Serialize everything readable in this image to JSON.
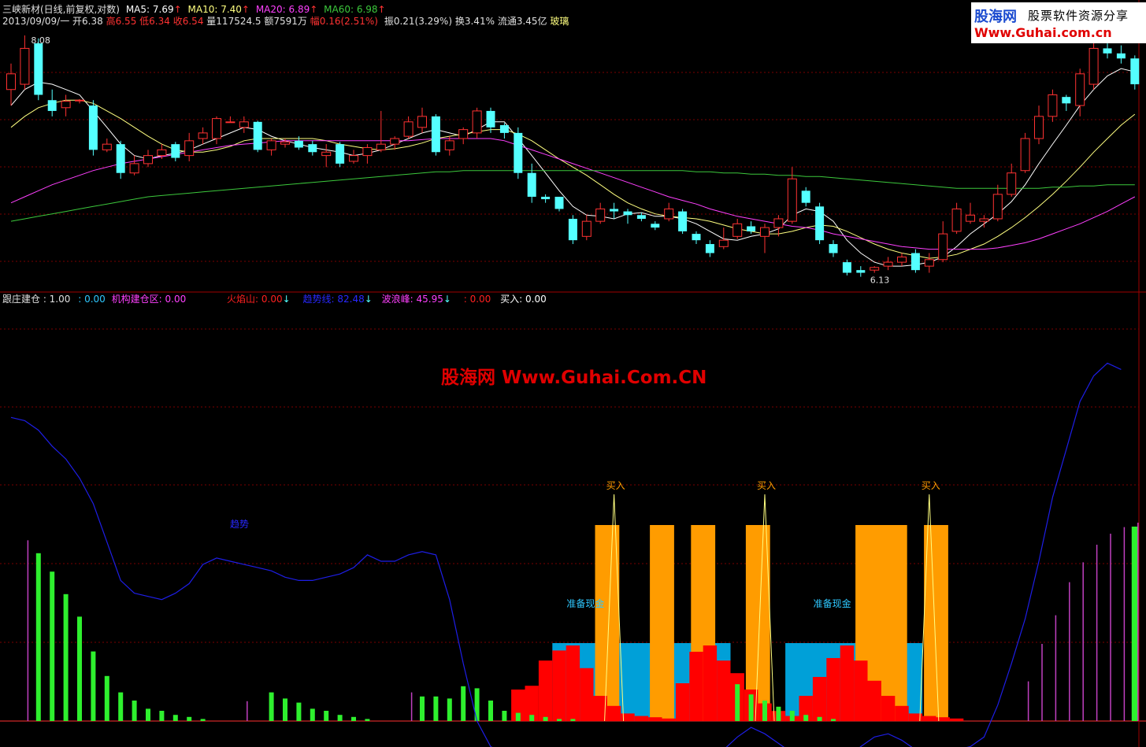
{
  "header": {
    "title": "三峡新材(日线,前复权,对数)",
    "ma5": "MA5: 7.69",
    "ma10": "MA10: 7.40",
    "ma20": "MA20: 6.89",
    "ma60": "MA60: 6.98",
    "up_arrow": "↑",
    "date": "2013/09/09/一",
    "open": "开6.38",
    "high": "高6.55",
    "low": "低6.34",
    "close": "收6.54",
    "volume": "量117524.5",
    "amount": "额7591万",
    "change": "幅0.16(2.51%)",
    "amplitude": "振0.21(3.29%)",
    "turnover": "换3.41%",
    "float": "流通3.45亿",
    "sector": "玻璃"
  },
  "watermark": {
    "logo": "股海网",
    "slogan": "股票软件资源分享",
    "url": "Www.Guhai.com.cn",
    "center": "股海网 Www.Guhai.Com.CN"
  },
  "indicator": {
    "label1": "跟庄建仓 : 1.00",
    "label2": ": 0.00",
    "label3": "机构建仓区: 0.00",
    "label4": "火焰山: 0.00",
    "label5": "趋势线: 82.48",
    "label6": "波浪峰: 45.95",
    "label7": ": 0.00",
    "label8": "买入: 0.00",
    "down_arrow": "↓"
  },
  "colors": {
    "up": "#ff3232",
    "down": "#54ffff",
    "ma5": "#ffffff",
    "ma10": "#ffff80",
    "ma20": "#ff40ff",
    "ma60": "#3cc83c",
    "trend": "#1e1ee6",
    "orange": "#ff9c00",
    "blue_zone": "#00a0d8",
    "fire": "#ff0000",
    "green_bar": "#2ef02e",
    "purple_bar": "#c040c0"
  },
  "chart_data": [
    {
      "type": "candlestick",
      "price_labels": {
        "max": "8.08",
        "min": "6.13"
      },
      "candles": [
        [
          7.55,
          7.8,
          7.4,
          7.7
        ],
        [
          7.6,
          8.08,
          7.55,
          7.95
        ],
        [
          8.0,
          8.05,
          7.45,
          7.5
        ],
        [
          7.45,
          7.55,
          7.3,
          7.35
        ],
        [
          7.38,
          7.5,
          7.3,
          7.44
        ],
        [
          7.45,
          7.46,
          7.42,
          7.45
        ],
        [
          7.4,
          7.45,
          6.95,
          7.0
        ],
        [
          7.0,
          7.1,
          6.98,
          7.05
        ],
        [
          7.05,
          7.08,
          6.75,
          6.8
        ],
        [
          6.8,
          6.95,
          6.78,
          6.88
        ],
        [
          6.88,
          7.0,
          6.85,
          6.95
        ],
        [
          6.95,
          7.05,
          6.92,
          7.0
        ],
        [
          7.05,
          7.07,
          6.9,
          6.93
        ],
        [
          6.95,
          7.15,
          6.9,
          7.08
        ],
        [
          7.1,
          7.2,
          7.05,
          7.15
        ],
        [
          7.1,
          7.3,
          7.05,
          7.28
        ],
        [
          7.25,
          7.3,
          7.25,
          7.25
        ],
        [
          7.2,
          7.3,
          7.15,
          7.25
        ],
        [
          7.25,
          7.26,
          6.98,
          7.0
        ],
        [
          7.0,
          7.1,
          6.95,
          7.08
        ],
        [
          7.05,
          7.1,
          7.02,
          7.07
        ],
        [
          7.08,
          7.12,
          7.0,
          7.02
        ],
        [
          7.05,
          7.08,
          6.95,
          6.98
        ],
        [
          6.95,
          7.05,
          6.85,
          6.98
        ],
        [
          7.05,
          7.07,
          6.85,
          6.88
        ],
        [
          6.9,
          7.0,
          6.88,
          6.95
        ],
        [
          6.95,
          7.05,
          6.88,
          7.02
        ],
        [
          7.0,
          7.35,
          6.98,
          7.05
        ],
        [
          7.05,
          7.12,
          7.0,
          7.1
        ],
        [
          7.12,
          7.3,
          7.1,
          7.25
        ],
        [
          7.2,
          7.38,
          7.15,
          7.3
        ],
        [
          7.3,
          7.32,
          6.95,
          6.98
        ],
        [
          7.0,
          7.12,
          6.95,
          7.08
        ],
        [
          7.1,
          7.2,
          7.05,
          7.18
        ],
        [
          7.15,
          7.38,
          7.1,
          7.35
        ],
        [
          7.35,
          7.38,
          7.15,
          7.2
        ],
        [
          7.22,
          7.24,
          7.1,
          7.15
        ],
        [
          7.15,
          7.2,
          6.75,
          6.8
        ],
        [
          6.8,
          6.88,
          6.55,
          6.6
        ],
        [
          6.6,
          6.62,
          6.55,
          6.58
        ],
        [
          6.6,
          6.6,
          6.48,
          6.5
        ],
        [
          6.42,
          6.45,
          6.22,
          6.25
        ],
        [
          6.28,
          6.45,
          6.25,
          6.4
        ],
        [
          6.4,
          6.55,
          6.38,
          6.5
        ],
        [
          6.5,
          6.55,
          6.42,
          6.48
        ],
        [
          6.48,
          6.5,
          6.38,
          6.45
        ],
        [
          6.45,
          6.47,
          6.4,
          6.42
        ],
        [
          6.38,
          6.4,
          6.33,
          6.35
        ],
        [
          6.42,
          6.55,
          6.4,
          6.5
        ],
        [
          6.48,
          6.5,
          6.3,
          6.32
        ],
        [
          6.3,
          6.32,
          6.22,
          6.25
        ],
        [
          6.22,
          6.25,
          6.12,
          6.15
        ],
        [
          6.2,
          6.35,
          6.18,
          6.25
        ],
        [
          6.28,
          6.42,
          6.26,
          6.38
        ],
        [
          6.36,
          6.4,
          6.3,
          6.32
        ],
        [
          6.28,
          6.38,
          6.15,
          6.35
        ],
        [
          6.35,
          6.45,
          6.28,
          6.42
        ],
        [
          6.4,
          6.85,
          6.38,
          6.75
        ],
        [
          6.65,
          6.68,
          6.52,
          6.55
        ],
        [
          6.52,
          6.55,
          6.22,
          6.25
        ],
        [
          6.22,
          6.25,
          6.12,
          6.15
        ],
        [
          6.08,
          6.1,
          5.98,
          6.0
        ],
        [
          6.02,
          6.05,
          5.97,
          6.0
        ],
        [
          6.02,
          6.05,
          6.0,
          6.04
        ],
        [
          6.05,
          6.12,
          6.02,
          6.08
        ],
        [
          6.08,
          6.15,
          6.05,
          6.12
        ],
        [
          6.15,
          6.18,
          6.0,
          6.02
        ],
        [
          6.05,
          6.15,
          6.0,
          6.1
        ],
        [
          6.1,
          6.4,
          6.08,
          6.3
        ],
        [
          6.32,
          6.55,
          6.3,
          6.5
        ],
        [
          6.4,
          6.55,
          6.38,
          6.45
        ],
        [
          6.4,
          6.45,
          6.35,
          6.42
        ],
        [
          6.42,
          6.7,
          6.4,
          6.62
        ],
        [
          6.62,
          6.88,
          6.6,
          6.8
        ],
        [
          6.82,
          7.15,
          6.8,
          7.1
        ],
        [
          7.1,
          7.4,
          7.05,
          7.3
        ],
        [
          7.3,
          7.55,
          7.25,
          7.5
        ],
        [
          7.48,
          7.5,
          7.35,
          7.42
        ],
        [
          7.4,
          7.75,
          7.3,
          7.7
        ],
        [
          7.6,
          8.05,
          7.55,
          7.95
        ],
        [
          7.95,
          8.0,
          7.85,
          7.9
        ],
        [
          7.9,
          7.98,
          7.8,
          7.85
        ],
        [
          7.85,
          7.88,
          7.55,
          7.6
        ]
      ],
      "series": [
        {
          "name": "MA5",
          "values": [
            7.4,
            7.55,
            7.62,
            7.6,
            7.55,
            7.5,
            7.35,
            7.2,
            7.05,
            6.95,
            6.92,
            6.95,
            6.97,
            7.0,
            7.05,
            7.1,
            7.15,
            7.2,
            7.18,
            7.12,
            7.08,
            7.05,
            7.02,
            7.0,
            6.98,
            6.95,
            6.97,
            7.0,
            7.05,
            7.1,
            7.15,
            7.18,
            7.15,
            7.12,
            7.18,
            7.25,
            7.25,
            7.1,
            6.95,
            6.8,
            6.65,
            6.52,
            6.45,
            6.44,
            6.42,
            6.46,
            6.47,
            6.44,
            6.44,
            6.42,
            6.38,
            6.32,
            6.26,
            6.25,
            6.28,
            6.3,
            6.34,
            6.45,
            6.5,
            6.48,
            6.4,
            6.25,
            6.15,
            6.08,
            6.05,
            6.05,
            6.06,
            6.08,
            6.12,
            6.2,
            6.3,
            6.38,
            6.46,
            6.56,
            6.7,
            6.88,
            7.05,
            7.22,
            7.4,
            7.55,
            7.68,
            7.75,
            7.72
          ]
        },
        {
          "name": "MA10",
          "values": [
            7.2,
            7.3,
            7.38,
            7.42,
            7.45,
            7.45,
            7.42,
            7.35,
            7.28,
            7.2,
            7.12,
            7.05,
            7.0,
            6.98,
            6.98,
            7.0,
            7.03,
            7.08,
            7.1,
            7.1,
            7.1,
            7.1,
            7.1,
            7.08,
            7.05,
            7.03,
            7.01,
            7.0,
            7.01,
            7.03,
            7.06,
            7.1,
            7.12,
            7.14,
            7.16,
            7.18,
            7.18,
            7.14,
            7.08,
            7.0,
            6.92,
            6.85,
            6.78,
            6.7,
            6.62,
            6.55,
            6.5,
            6.46,
            6.44,
            6.43,
            6.42,
            6.4,
            6.37,
            6.34,
            6.32,
            6.3,
            6.3,
            6.32,
            6.35,
            6.37,
            6.36,
            6.32,
            6.27,
            6.22,
            6.18,
            6.15,
            6.13,
            6.11,
            6.12,
            6.14,
            6.18,
            6.22,
            6.28,
            6.35,
            6.43,
            6.52,
            6.62,
            6.73,
            6.85,
            6.98,
            7.1,
            7.22,
            7.32
          ]
        },
        {
          "name": "MA20",
          "values": [
            6.55,
            6.6,
            6.65,
            6.7,
            6.74,
            6.78,
            6.82,
            6.85,
            6.88,
            6.9,
            6.92,
            6.94,
            6.96,
            6.98,
            7.0,
            7.02,
            7.04,
            7.05,
            7.06,
            7.07,
            7.08,
            7.08,
            7.08,
            7.08,
            7.08,
            7.08,
            7.08,
            7.08,
            7.08,
            7.08,
            7.09,
            7.1,
            7.1,
            7.1,
            7.1,
            7.1,
            7.08,
            7.04,
            7.0,
            6.96,
            6.92,
            6.88,
            6.84,
            6.8,
            6.76,
            6.72,
            6.68,
            6.64,
            6.6,
            6.57,
            6.54,
            6.5,
            6.47,
            6.44,
            6.42,
            6.4,
            6.38,
            6.36,
            6.35,
            6.33,
            6.3,
            6.28,
            6.26,
            6.24,
            6.22,
            6.2,
            6.19,
            6.18,
            6.18,
            6.18,
            6.18,
            6.18,
            6.19,
            6.21,
            6.23,
            6.26,
            6.3,
            6.34,
            6.38,
            6.43,
            6.48,
            6.54,
            6.6
          ]
        },
        {
          "name": "MA60",
          "values": [
            6.4,
            6.42,
            6.44,
            6.46,
            6.48,
            6.5,
            6.52,
            6.54,
            6.56,
            6.58,
            6.6,
            6.61,
            6.62,
            6.63,
            6.64,
            6.65,
            6.66,
            6.67,
            6.68,
            6.69,
            6.7,
            6.71,
            6.72,
            6.73,
            6.74,
            6.75,
            6.76,
            6.77,
            6.78,
            6.79,
            6.8,
            6.81,
            6.81,
            6.82,
            6.82,
            6.82,
            6.82,
            6.82,
            6.82,
            6.82,
            6.82,
            6.82,
            6.82,
            6.82,
            6.82,
            6.82,
            6.82,
            6.82,
            6.82,
            6.82,
            6.81,
            6.81,
            6.8,
            6.8,
            6.79,
            6.79,
            6.78,
            6.78,
            6.77,
            6.77,
            6.76,
            6.75,
            6.74,
            6.73,
            6.72,
            6.71,
            6.7,
            6.69,
            6.68,
            6.67,
            6.67,
            6.67,
            6.67,
            6.67,
            6.67,
            6.67,
            6.68,
            6.68,
            6.69,
            6.69,
            6.7,
            6.7,
            6.7
          ]
        }
      ]
    },
    {
      "type": "bar",
      "labels": {
        "trend": "趋势",
        "prepare": "准备现金",
        "buy": "买入"
      },
      "trend_line": [
        95,
        94,
        91,
        86,
        82,
        76,
        68,
        56,
        44,
        40,
        39,
        38,
        40,
        43,
        49,
        51,
        50,
        49,
        48,
        47,
        45,
        44,
        44,
        45,
        46,
        48,
        52,
        50,
        50,
        52,
        53,
        52,
        38,
        18,
        0,
        -8,
        -10,
        -10,
        -9,
        -10,
        -10,
        -10,
        -9,
        -9,
        -10,
        -11,
        -12,
        -13,
        -14,
        -15,
        -14,
        -12,
        -9,
        -5,
        -2,
        -4,
        -7,
        -10,
        -10,
        -13,
        -15,
        -12,
        -8,
        -5,
        -4,
        -6,
        -9,
        -10,
        -10,
        -9,
        -8,
        -5,
        5,
        18,
        32,
        50,
        70,
        85,
        100,
        108,
        112,
        110
      ],
      "green_bars": [
        0,
        0,
        82,
        73,
        62,
        51,
        34,
        22,
        14,
        10,
        6,
        5,
        3,
        2,
        1,
        0,
        0,
        0,
        0,
        14,
        11,
        9,
        6,
        5,
        3,
        2,
        1,
        0,
        0,
        0,
        12,
        12,
        11,
        17,
        16,
        10,
        5,
        4,
        3,
        2,
        1,
        1,
        0,
        0,
        0,
        0,
        0,
        0,
        0,
        0,
        0,
        0,
        0,
        18,
        13,
        10,
        7,
        5,
        3,
        2,
        1,
        0,
        0,
        0,
        0,
        0,
        0,
        0,
        0,
        0,
        0,
        0,
        0,
        0,
        0,
        0,
        0,
        0,
        0,
        0,
        0,
        0,
        95
      ],
      "purple_bars": [
        0,
        82,
        0,
        0,
        0,
        0,
        0,
        0,
        0,
        0,
        0,
        0,
        0,
        0,
        0,
        0,
        0,
        9,
        0,
        0,
        0,
        0,
        0,
        0,
        0,
        0,
        0,
        0,
        0,
        13,
        0,
        0,
        0,
        0,
        0,
        0,
        0,
        0,
        0,
        0,
        0,
        0,
        0,
        0,
        0,
        0,
        0,
        0,
        0,
        0,
        0,
        0,
        0,
        0,
        0,
        0,
        0,
        0,
        0,
        0,
        0,
        0,
        0,
        0,
        0,
        0,
        0,
        0,
        0,
        0,
        0,
        0,
        0,
        0,
        18,
        35,
        48,
        63,
        72,
        80,
        85,
        88,
        90
      ],
      "fire_bars": [
        0,
        0,
        0,
        0,
        0,
        0,
        0,
        0,
        0,
        0,
        0,
        0,
        0,
        0,
        0,
        0,
        0,
        0,
        0,
        0,
        0,
        0,
        0,
        0,
        0,
        0,
        0,
        0,
        0,
        0,
        0,
        0,
        0,
        0,
        0,
        0,
        0,
        0,
        0,
        0,
        0,
        0,
        0,
        0,
        0,
        0,
        0,
        0,
        0,
        0,
        0,
        0,
        0,
        0,
        0,
        0,
        0,
        0,
        0,
        0,
        0,
        0,
        0,
        0,
        0,
        0,
        0,
        0,
        0,
        0,
        0,
        0,
        0,
        0,
        0,
        0,
        0,
        0,
        0,
        0,
        0,
        0,
        0
      ],
      "orange_zones": [
        [
          43,
          44
        ],
        [
          47,
          48
        ],
        [
          50,
          51
        ],
        [
          54,
          55
        ],
        [
          62,
          65
        ],
        [
          67,
          68
        ]
      ],
      "blue_zones": [
        [
          40,
          52
        ],
        [
          57,
          66
        ]
      ],
      "buy_points": [
        44,
        55,
        67
      ],
      "prepare_points": [
        41,
        59
      ],
      "fire_zones": [
        {
          "start": 37,
          "heights": [
            25,
            28,
            48,
            56,
            60,
            42,
            20,
            12,
            6,
            4,
            3,
            2
          ]
        },
        {
          "start": 49,
          "heights": [
            30,
            55,
            60,
            48,
            38,
            25,
            14,
            8,
            4,
            3
          ]
        },
        {
          "start": 58,
          "heights": [
            20,
            35,
            50,
            60,
            48,
            32,
            20,
            12,
            6,
            4,
            3,
            2
          ]
        }
      ]
    }
  ]
}
